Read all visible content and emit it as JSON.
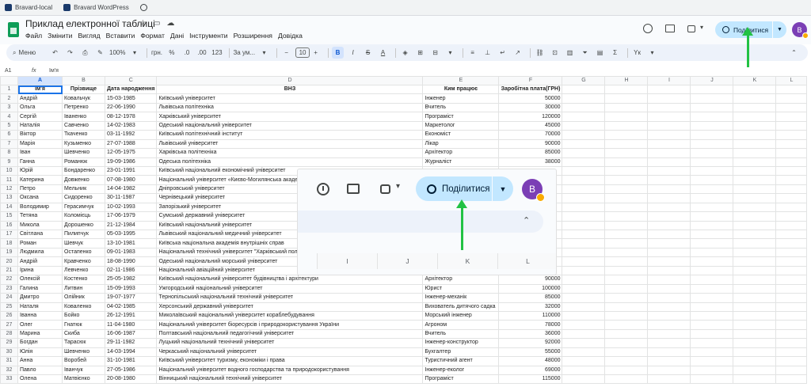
{
  "bookmarks": [
    {
      "label": "Bravard-local"
    },
    {
      "label": "Bravard WordPress"
    }
  ],
  "header": {
    "title": "Приклад електронної таблиці",
    "menu": [
      "Файл",
      "Змінити",
      "Вигляд",
      "Вставити",
      "Формат",
      "Дані",
      "Інструменти",
      "Розширення",
      "Довідка"
    ],
    "share_label": "Поділитися",
    "avatar_letter": "B"
  },
  "toolbar": {
    "search_label": "Меню",
    "zoom": "100%",
    "currency": "грн.",
    "percent": "%",
    "dec_decrease": ".0",
    "dec_increase": ".00",
    "number_format": "123",
    "font": "За ум...",
    "font_size": "10",
    "bold": "B",
    "italic": "I",
    "strike": "S",
    "text_color": "A",
    "sum": "Σ",
    "input_tools": "Yк"
  },
  "formula_bar": {
    "cell_ref": "A1",
    "fx": "fx",
    "value": "Ім'я"
  },
  "columns": [
    "A",
    "B",
    "C",
    "D",
    "E",
    "F",
    "G",
    "H",
    "I",
    "J",
    "K",
    "L"
  ],
  "rows": [
    [
      "Ім'я",
      "Прізвище",
      "Дата народження",
      "ВНЗ",
      "Ким працює",
      "Заробітна плата(ГРН)"
    ],
    [
      "Андрій",
      "Ковальчук",
      "15-03-1985",
      "Київський університет",
      "Інженер",
      "50000"
    ],
    [
      "Ольга",
      "Петренко",
      "22-06-1990",
      "Львівська політехніка",
      "Вчитель",
      "30000"
    ],
    [
      "Сергій",
      "Іваненко",
      "08-12-1978",
      "Харківський університет",
      "Програміст",
      "120000"
    ],
    [
      "Наталія",
      "Савченко",
      "14-02-1983",
      "Одеський національний університет",
      "Маркетолог",
      "45000"
    ],
    [
      "Віктор",
      "Ткаченко",
      "03-11-1992",
      "Київський політехнічний інститут",
      "Економіст",
      "70000"
    ],
    [
      "Марія",
      "Кузьменко",
      "27-07-1988",
      "Львівський університет",
      "Лікар",
      "90000"
    ],
    [
      "Іван",
      "Шевченко",
      "12-05-1975",
      "Харківська політехніка",
      "Архітектор",
      "85000"
    ],
    [
      "Ганна",
      "Романюк",
      "19-09-1986",
      "Одеська політехніка",
      "Журналіст",
      "38000"
    ],
    [
      "Юрій",
      "Бондаренко",
      "23-01-1991",
      "Київський національний економічний університет",
      "",
      ""
    ],
    [
      "Катерина",
      "Довженко",
      "07-08-1980",
      "Національний університет «Києво-Могилянська акаде",
      "",
      ""
    ],
    [
      "Петро",
      "Мельник",
      "14-04-1982",
      "Дніпровський університет",
      "",
      ""
    ],
    [
      "Оксана",
      "Сидоренко",
      "30-11-1987",
      "Чернівецький університет",
      "",
      ""
    ],
    [
      "Володимир",
      "Герасимчук",
      "10-02-1993",
      "Запорізький університет",
      "",
      ""
    ],
    [
      "Тетяна",
      "Коломієць",
      "17-06-1979",
      "Сумський державний університет",
      "",
      ""
    ],
    [
      "Микола",
      "Дорошенко",
      "21-12-1984",
      "Київський національний університет",
      "",
      ""
    ],
    [
      "Світлана",
      "Пилипчук",
      "05-03-1995",
      "Львівський національний медичний університет",
      "",
      ""
    ],
    [
      "Роман",
      "Шевчук",
      "13-10-1981",
      "Київська національна академія внутрішніх справ",
      "",
      ""
    ],
    [
      "Людмила",
      "Остапенко",
      "09-01-1983",
      "Національний технічний університет \"Харківський пол",
      "",
      ""
    ],
    [
      "Андрій",
      "Кравченко",
      "18-08-1990",
      "Одеський національний морський університет",
      "",
      ""
    ],
    [
      "Ірина",
      "Левченко",
      "02-11-1986",
      "Національний авіаційний університет",
      "",
      ""
    ],
    [
      "Олексій",
      "Костенко",
      "25-05-1982",
      "Київський національний університет будівництва і архітектури",
      "Архітектор",
      "90000"
    ],
    [
      "Галина",
      "Литвин",
      "15-09-1993",
      "Ужгородський національний університет",
      "Юрист",
      "100000"
    ],
    [
      "Дмитро",
      "Олійник",
      "19-07-1977",
      "Тернопільський національний технічний університет",
      "Інженер-механік",
      "85000"
    ],
    [
      "Наталя",
      "Коваленко",
      "04-02-1985",
      "Херсонський державний університет",
      "Вихователь дитячого садка",
      "32000"
    ],
    [
      "Іванна",
      "Бойко",
      "26-12-1991",
      "Миколаївський національний університет кораблебудування",
      "Морський інженер",
      "110000"
    ],
    [
      "Олег",
      "Гнатюк",
      "11-04-1980",
      "Національний університет біоресурсів і природокористування України",
      "Агроном",
      "78000"
    ],
    [
      "Марина",
      "Скиба",
      "16-06-1987",
      "Полтавський національний педагогічний університет",
      "Вчитель",
      "36000"
    ],
    [
      "Богдан",
      "Тарасюк",
      "29-11-1982",
      "Луцький національний технічний університет",
      "Інженер-конструктор",
      "92000"
    ],
    [
      "Юлія",
      "Шевченко",
      "14-03-1994",
      "Черкаський національний університет",
      "Бухгалтер",
      "55000"
    ],
    [
      "Анна",
      "Воробей",
      "31-10-1981",
      "Київський університет туризму, економіки і права",
      "Туристичний агент",
      "48000"
    ],
    [
      "Павло",
      "Іванчук",
      "27-05-1986",
      "Національний університет водного господарства та природокористування",
      "Інженер-еколог",
      "69000"
    ],
    [
      "Олена",
      "Матвієнко",
      "20-08-1980",
      "Вінницький національний технічний університет",
      "Програміст",
      "115000"
    ]
  ],
  "zoom_popup": {
    "share_label": "Поділитися",
    "avatar_letter": "B",
    "columns": [
      "I",
      "J",
      "K",
      "L"
    ]
  },
  "colors": {
    "share_bg": "#c2e7ff",
    "toolbar_bg": "#edf2fa",
    "arrow": "#22c244",
    "avatar": "#7b3fb5"
  }
}
